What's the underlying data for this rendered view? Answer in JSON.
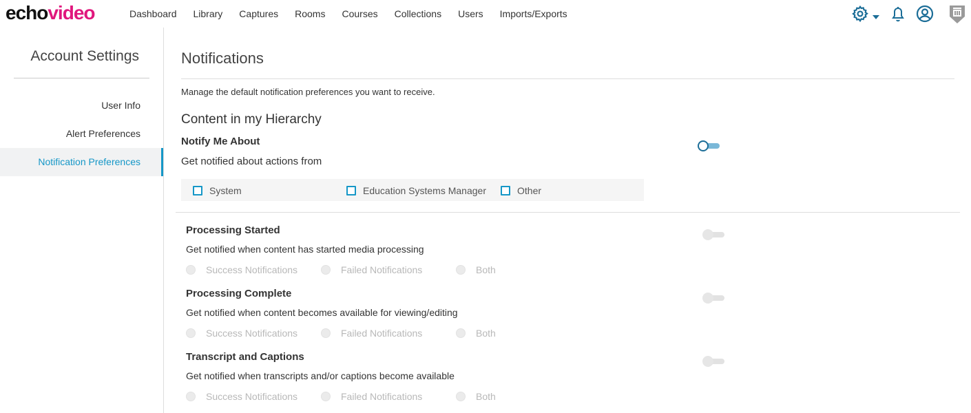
{
  "brand": {
    "echo": "echo",
    "video": "video"
  },
  "nav": [
    "Dashboard",
    "Library",
    "Captures",
    "Rooms",
    "Courses",
    "Collections",
    "Users",
    "Imports/Exports"
  ],
  "icons": {
    "settings": "gear-icon",
    "caret": "caret-down-icon",
    "notifications": "bell-icon",
    "account": "user-circle-icon",
    "institution": "shield-badge-icon"
  },
  "colors": {
    "accent": "#1597c7",
    "brand_pink": "#e0177d",
    "icon_blue": "#1b6d97"
  },
  "sidebar": {
    "title": "Account Settings",
    "items": [
      {
        "label": "User Info",
        "active": false
      },
      {
        "label": "Alert Preferences",
        "active": false
      },
      {
        "label": "Notification Preferences",
        "active": true
      }
    ]
  },
  "page": {
    "title": "Notifications",
    "description": "Manage the default notification preferences you want to receive.",
    "section_title": "Content in my Hierarchy"
  },
  "notify_me": {
    "heading": "Notify Me About",
    "subtext": "Get notified about actions from",
    "enabled": true,
    "options": [
      {
        "label": "System",
        "checked": false
      },
      {
        "label": "Education Systems Manager",
        "checked": false
      },
      {
        "label": "Other",
        "checked": false
      }
    ]
  },
  "groups": [
    {
      "heading": "Processing Started",
      "subtext": "Get notified when content has started media processing",
      "enabled": false,
      "options": [
        "Success Notifications",
        "Failed Notifications",
        "Both"
      ]
    },
    {
      "heading": "Processing Complete",
      "subtext": "Get notified when content becomes available for viewing/editing",
      "enabled": false,
      "options": [
        "Success Notifications",
        "Failed Notifications",
        "Both"
      ]
    },
    {
      "heading": "Transcript and Captions",
      "subtext": "Get notified when transcripts and/or captions become available",
      "enabled": false,
      "options": [
        "Success Notifications",
        "Failed Notifications",
        "Both"
      ]
    }
  ]
}
